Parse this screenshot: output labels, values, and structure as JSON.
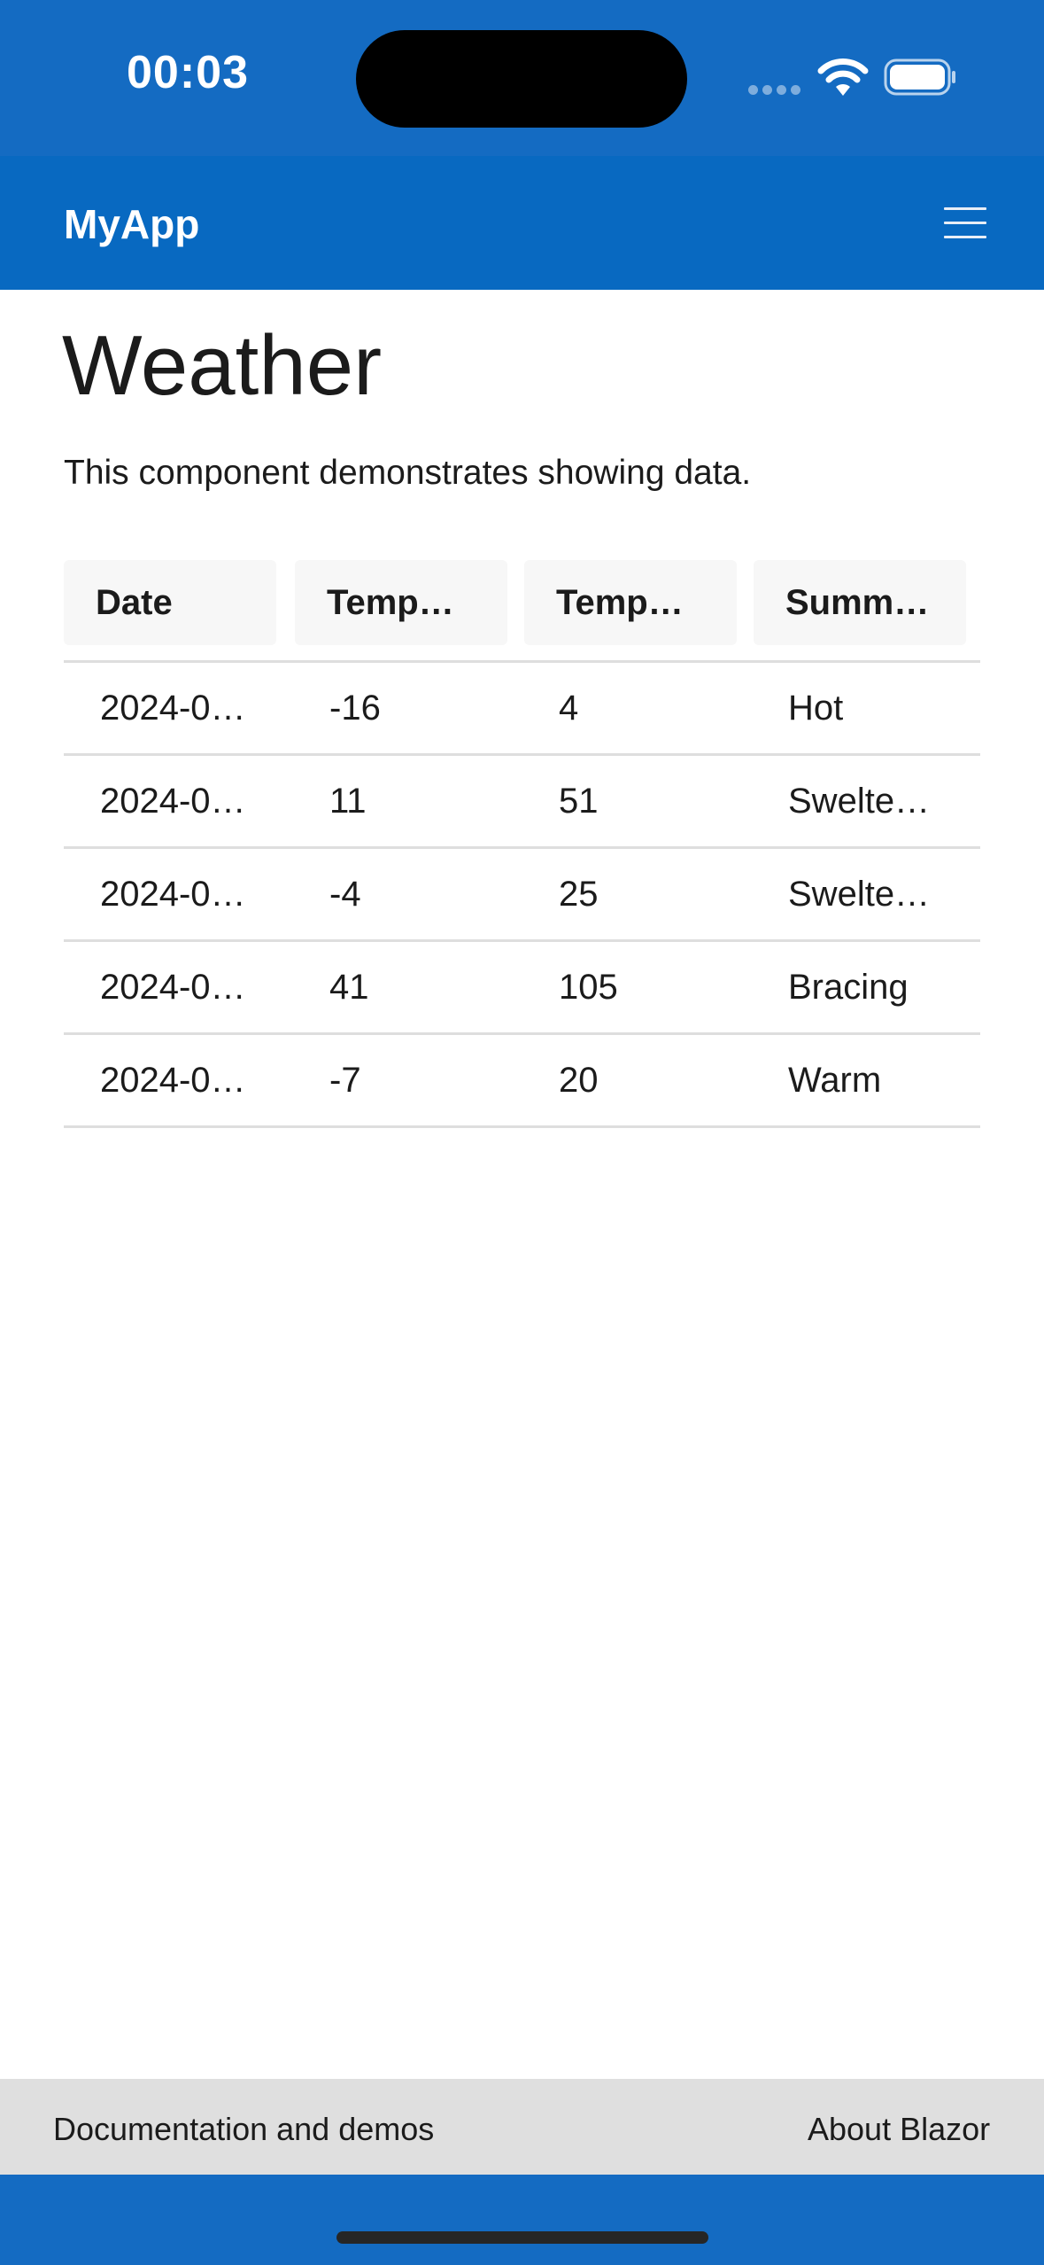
{
  "status_bar": {
    "time": "00:03",
    "icons": [
      "signal-icon",
      "wifi-icon",
      "battery-icon"
    ]
  },
  "navbar": {
    "brand": "MyApp",
    "menu_icon": "hamburger-menu-icon"
  },
  "main": {
    "title": "Weather",
    "description": "This component demonstrates showing data.",
    "table": {
      "headers": [
        "Date",
        "Temp…",
        "Temp…",
        "Summ…"
      ],
      "rows": [
        [
          "2024-0…",
          "-16",
          "4",
          "Hot"
        ],
        [
          "2024-0…",
          "11",
          "51",
          "Swelte…"
        ],
        [
          "2024-0…",
          "-4",
          "25",
          "Swelte…"
        ],
        [
          "2024-0…",
          "41",
          "105",
          "Bracing"
        ],
        [
          "2024-0…",
          "-7",
          "20",
          "Warm"
        ]
      ]
    }
  },
  "footer": {
    "links": [
      "Documentation and demos",
      "About Blazor"
    ]
  },
  "colors": {
    "status_bar": "#146bc2",
    "navbar": "#0869c1",
    "footer": "#dfdfdf",
    "text": "#1b1b1b"
  }
}
